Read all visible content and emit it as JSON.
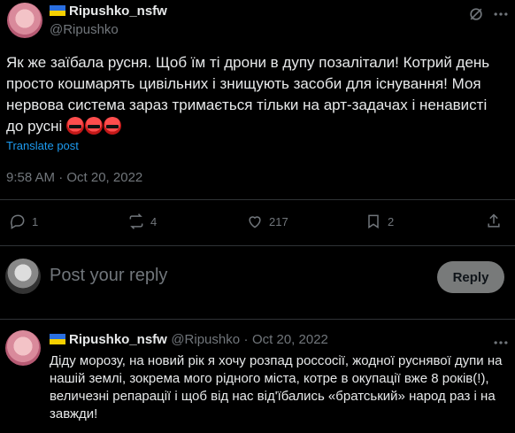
{
  "tweet": {
    "display_name": "Ripushko_nsfw",
    "handle": "@Ripushko",
    "text": "Як же заїбала русня. Щоб їм ті дрони в дупу позалітали! Котрий день просто кошмарять цивільних і знищують засоби для існування! Моя нервова система зараз тримається тільки на арт-задачах і ненависті до русні",
    "emoji_count": 3,
    "translate_label": "Translate post",
    "timestamp": "9:58 AM · Oct 20, 2022",
    "stats": {
      "replies": "1",
      "reposts": "4",
      "likes": "217",
      "views": "2"
    },
    "flag_colors": [
      "#2a6fe0",
      "#f5d000"
    ]
  },
  "reply_box": {
    "placeholder": "Post your reply",
    "button_label": "Reply"
  },
  "comment": {
    "display_name": "Ripushko_nsfw",
    "handle": "@Ripushko",
    "separator": "·",
    "date": "Oct 20, 2022",
    "text": "Діду морозу, на новий рік я хочу розпад россосії, жодної руснявої дупи на нашій землі, зокрема мого рідного міста, котре в окупації вже 8 років(!), величезні репарації і щоб від нас від'їбались «братський» народ раз і на завжди!"
  },
  "colors": {
    "background": "#000000",
    "text": "#e7e9ea",
    "muted": "#71767b",
    "link": "#1d9bf0",
    "divider": "#2f3336",
    "reply_button_bg": "#787a7a"
  }
}
